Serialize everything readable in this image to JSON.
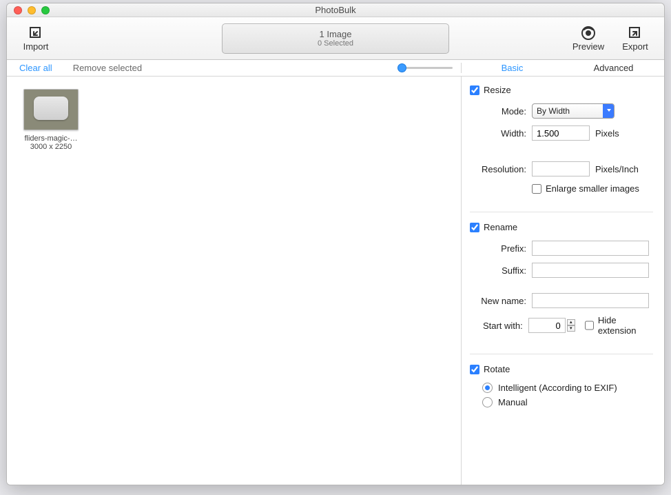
{
  "title": "PhotoBulk",
  "toolbar": {
    "import": "Import",
    "preview": "Preview",
    "export": "Export"
  },
  "status": {
    "line1": "1 Image",
    "line2": "0 Selected"
  },
  "subbar": {
    "clear_all": "Clear all",
    "remove_selected": "Remove selected"
  },
  "tabs": {
    "basic": "Basic",
    "advanced": "Advanced"
  },
  "thumb": {
    "name": "fliders-magic-…",
    "dims": "3000 x 2250"
  },
  "resize": {
    "title": "Resize",
    "mode_label": "Mode:",
    "mode_value": "By Width",
    "width_label": "Width:",
    "width_value": "1.500",
    "width_unit": "Pixels",
    "resolution_label": "Resolution:",
    "resolution_value": "",
    "resolution_unit": "Pixels/Inch",
    "enlarge_label": "Enlarge smaller images"
  },
  "rename": {
    "title": "Rename",
    "prefix_label": "Prefix:",
    "prefix_value": "",
    "suffix_label": "Suffix:",
    "suffix_value": "",
    "newname_label": "New name:",
    "newname_value": "",
    "startwith_label": "Start with:",
    "startwith_value": "0",
    "hideext_label": "Hide extension"
  },
  "rotate": {
    "title": "Rotate",
    "intelligent": "Intelligent (According to EXIF)",
    "manual": "Manual"
  }
}
